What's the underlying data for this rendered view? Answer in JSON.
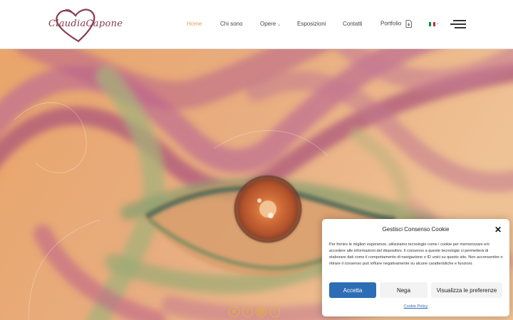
{
  "logo": {
    "text": "ClaudiaCapone"
  },
  "nav": {
    "items": [
      {
        "label": "Home",
        "active": true
      },
      {
        "label": "Chi sono"
      },
      {
        "label": "Opere",
        "has_dropdown": true
      },
      {
        "label": "Esposizioni"
      },
      {
        "label": "Contatti"
      },
      {
        "label": "Portfolio",
        "icon": "download-file-icon"
      }
    ],
    "language": {
      "icon": "italian-flag-icon",
      "colors": [
        "#009246",
        "#ffffff",
        "#ce2b37"
      ]
    },
    "menu_icon": "hamburger-menu-icon"
  },
  "hero": {
    "image": "pastel-eye-artwork"
  },
  "socials": [
    {
      "icon": "flower-icon"
    },
    {
      "icon": "facebook-icon"
    },
    {
      "icon": "instagram-icon"
    },
    {
      "icon": "tiktok-icon"
    }
  ],
  "cookie": {
    "title": "Gestisci Consenso Cookie",
    "text": "Per fornire le migliori esperienze, utilizziamo tecnologie come i cookie per memorizzare e/o accedere alle informazioni del dispositivo. Il consenso a queste tecnologie ci permetterà di elaborare dati come il comportamento di navigazione o ID unici su questo sito. Non acconsentire o ritirare il consenso può influire negativamente su alcune caratteristiche e funzioni.",
    "accept": "Accetta",
    "deny": "Nega",
    "preferences": "Visualizza le preferenze",
    "policy": "Cookie Policy"
  },
  "colors": {
    "accent": "#e2a15a",
    "button_blue": "#2d6db5",
    "social_gold": "#e4b23a",
    "logo": "#8a3c4e"
  }
}
